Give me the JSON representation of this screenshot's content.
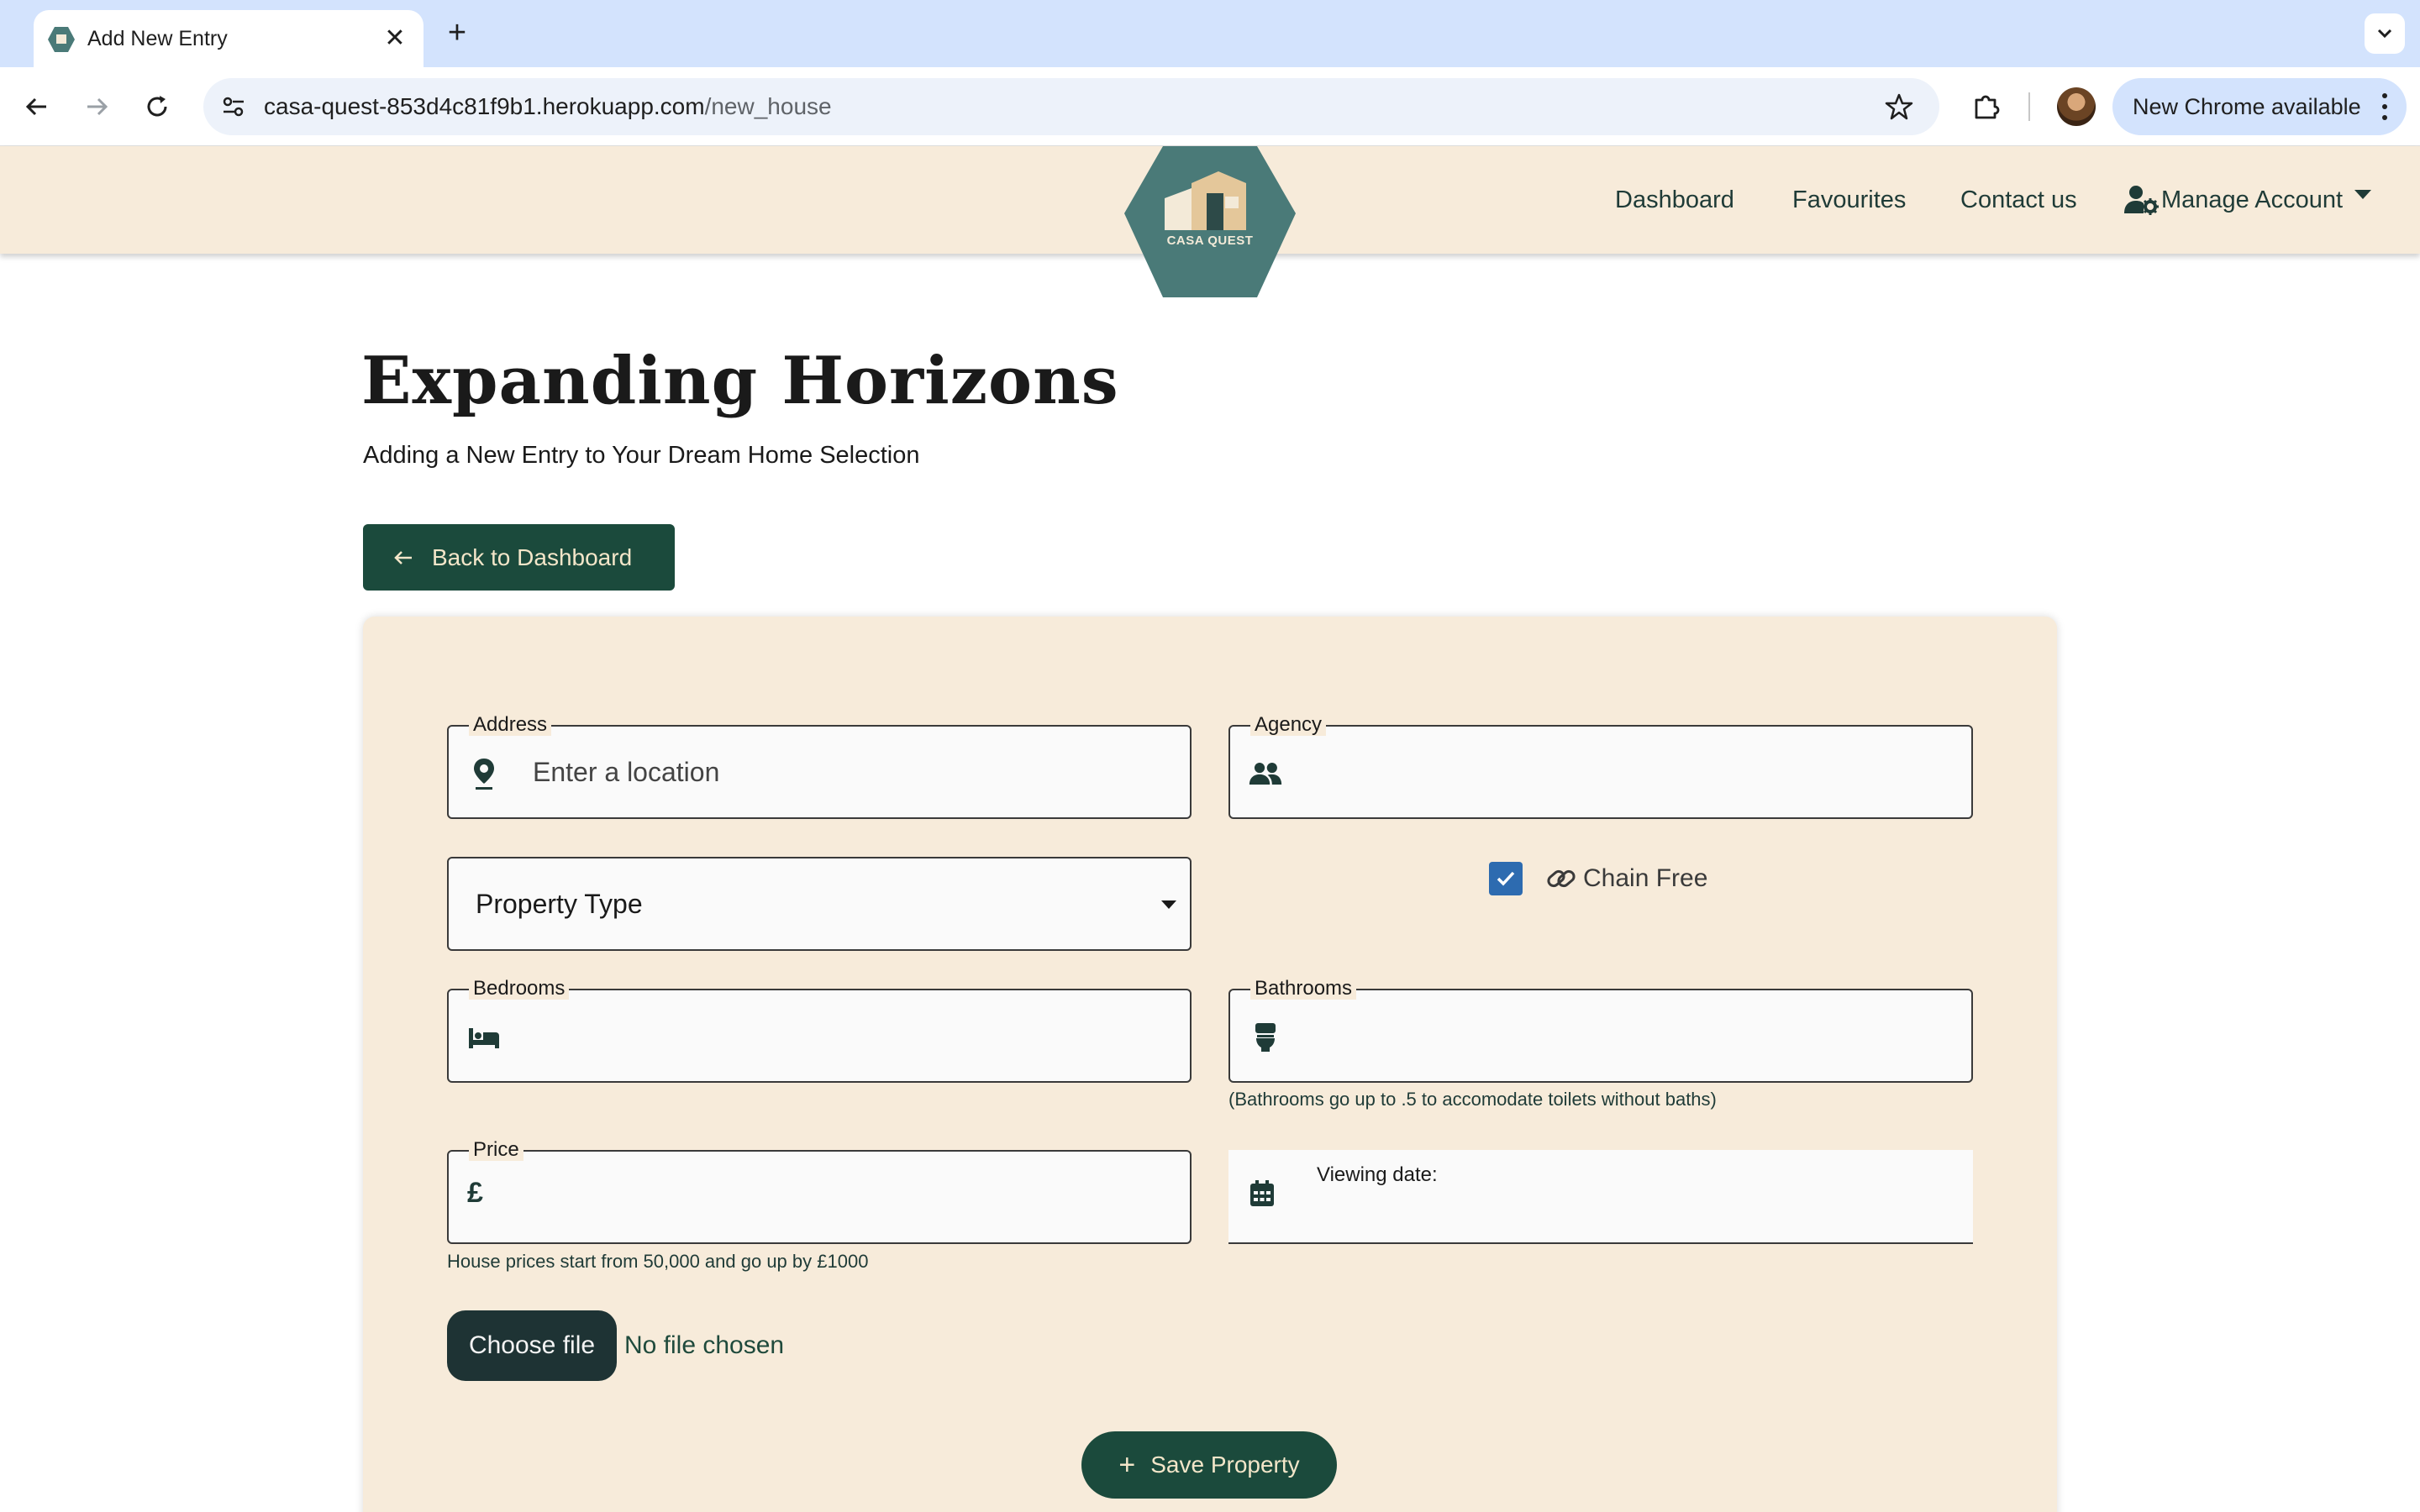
{
  "browser": {
    "tab_title": "Add New Entry",
    "url_host": "casa-quest-853d4c81f9b1.herokuapp.com",
    "url_path": "/new_house",
    "update_label": "New Chrome available"
  },
  "nav": {
    "logo_text": "CASA QUEST",
    "links": [
      "Dashboard",
      "Favourites",
      "Contact us"
    ],
    "manage_account": "Manage Account"
  },
  "page": {
    "title": "Expanding Horizons",
    "subtitle": "Adding a New Entry to Your Dream Home Selection",
    "back_button": "Back to Dashboard"
  },
  "form": {
    "address": {
      "label": "Address",
      "placeholder": "Enter a location",
      "value": ""
    },
    "agency": {
      "label": "Agency",
      "value": ""
    },
    "property_type": {
      "selected": "Property Type"
    },
    "chain_free": {
      "label": "Chain Free",
      "checked": true
    },
    "bedrooms": {
      "label": "Bedrooms",
      "value": ""
    },
    "bathrooms": {
      "label": "Bathrooms",
      "value": "",
      "hint": "(Bathrooms go up to .5 to accomodate toilets without baths)"
    },
    "price": {
      "label": "Price",
      "currency": "£",
      "value": "",
      "hint": "House prices start from 50,000 and go up by £1000"
    },
    "viewing_date": {
      "label": "Viewing date:"
    },
    "file": {
      "button": "Choose file",
      "status": "No file chosen"
    },
    "save_button": "Save Property"
  },
  "colors": {
    "nav_bg": "#f7ebda",
    "brand_green": "#1b4a3c",
    "logo_teal": "#4a7a78",
    "checkbox_blue": "#2d6bb0"
  }
}
